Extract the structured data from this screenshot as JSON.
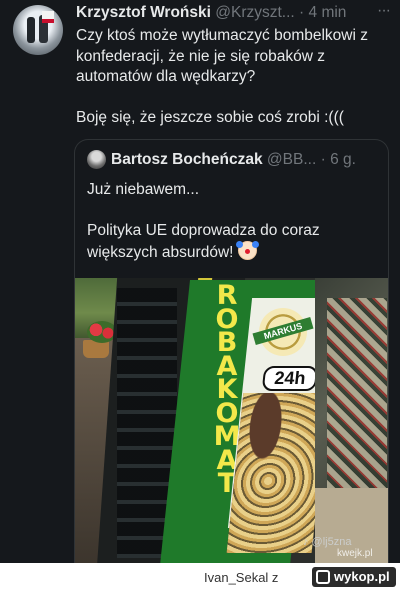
{
  "tweet": {
    "author_name": "Krzysztof Wroński",
    "handle": "@Krzyszt...",
    "separator": "·",
    "time": "4 min",
    "more_label": "···",
    "text_p1": "Czy ktoś może wytłumaczyć bombelkowi z konfederacji, że nie je się robaków z automatów dla wędkarzy?",
    "text_p2": "Boję się, że jeszcze sobie coś zrobi :((("
  },
  "quoted": {
    "author_name": "Bartosz Bocheńczak",
    "handle": "@BB...",
    "separator": "·",
    "time": "6 g.",
    "text_p1": "Już niebawem...",
    "text_p2": "Polityka UE doprowadza do coraz większych absurdów!",
    "emoji": "clown-face-icon",
    "photo": {
      "sign_letters": [
        "R",
        "O",
        "B",
        "A",
        "K",
        "O",
        "M",
        "A",
        "T"
      ],
      "seal_text": "MARKUS",
      "hours_text": "24h",
      "watermark_tiktok": "♪ @lj5zna",
      "watermark_kwejk": "kwejk.pl"
    }
  },
  "footer": {
    "username": "Ivan_Sekal z",
    "logo_text": "wykop.pl"
  },
  "colors": {
    "card_bg": "#15181c",
    "primary_text": "#e7e9ea",
    "secondary_text": "#71767b",
    "border": "#2f3336",
    "sign_green": "#1f7a2a",
    "sign_yellow": "#f3e84a"
  }
}
